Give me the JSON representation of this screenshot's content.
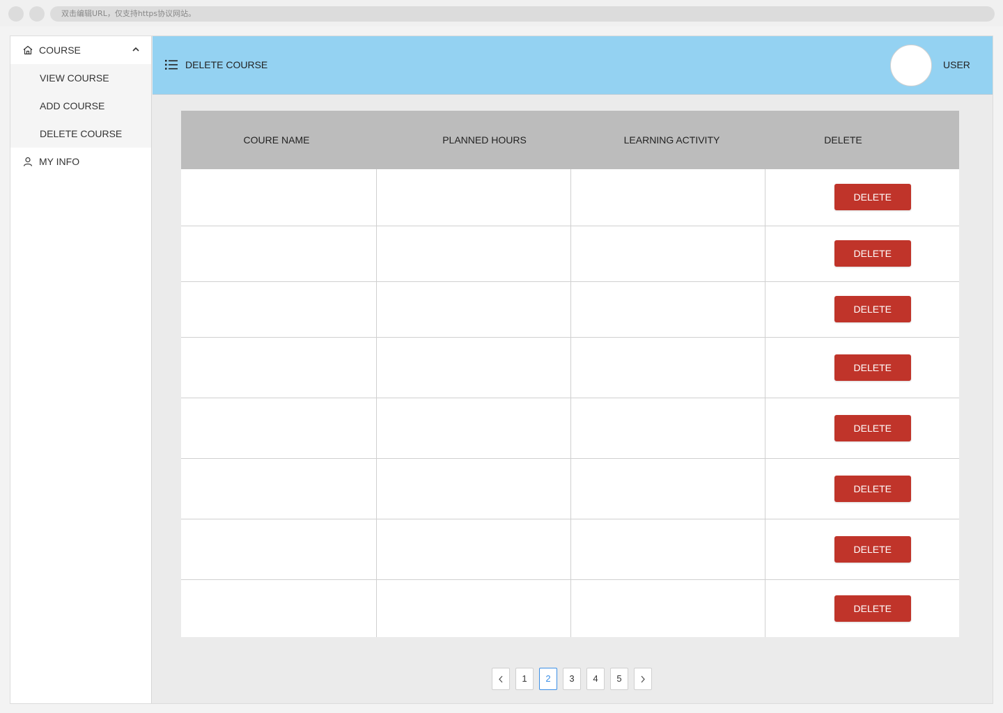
{
  "browser": {
    "url_hint": "双击编辑URL，仅支持https协议网站。"
  },
  "sidebar": {
    "course_group": {
      "label": "COURSE",
      "icon": "home-icon",
      "expanded": true
    },
    "course_items": [
      {
        "label": "VIEW COURSE"
      },
      {
        "label": "ADD COURSE"
      },
      {
        "label": "DELETE COURSE"
      }
    ],
    "my_info": {
      "label": "MY INFO",
      "icon": "user-icon"
    }
  },
  "header": {
    "title": "DELETE COURSE",
    "user_label": "USER"
  },
  "table": {
    "columns": [
      "COURE NAME",
      "PLANNED HOURS",
      "LEARNING ACTIVITY",
      "DELETE"
    ],
    "rows": [
      {
        "course_name": "",
        "planned_hours": "",
        "learning_activity": "",
        "action": "DELETE"
      },
      {
        "course_name": "",
        "planned_hours": "",
        "learning_activity": "",
        "action": "DELETE"
      },
      {
        "course_name": "",
        "planned_hours": "",
        "learning_activity": "",
        "action": "DELETE"
      },
      {
        "course_name": "",
        "planned_hours": "",
        "learning_activity": "",
        "action": "DELETE"
      },
      {
        "course_name": "",
        "planned_hours": "",
        "learning_activity": "",
        "action": "DELETE"
      },
      {
        "course_name": "",
        "planned_hours": "",
        "learning_activity": "",
        "action": "DELETE"
      },
      {
        "course_name": "",
        "planned_hours": "",
        "learning_activity": "",
        "action": "DELETE"
      },
      {
        "course_name": "",
        "planned_hours": "",
        "learning_activity": "",
        "action": "DELETE"
      }
    ]
  },
  "pagination": {
    "pages": [
      "1",
      "2",
      "3",
      "4",
      "5"
    ],
    "current": "2"
  },
  "colors": {
    "header_bg": "#94d2f2",
    "delete_button": "#c0342a",
    "active_page": "#3a8ee6"
  }
}
